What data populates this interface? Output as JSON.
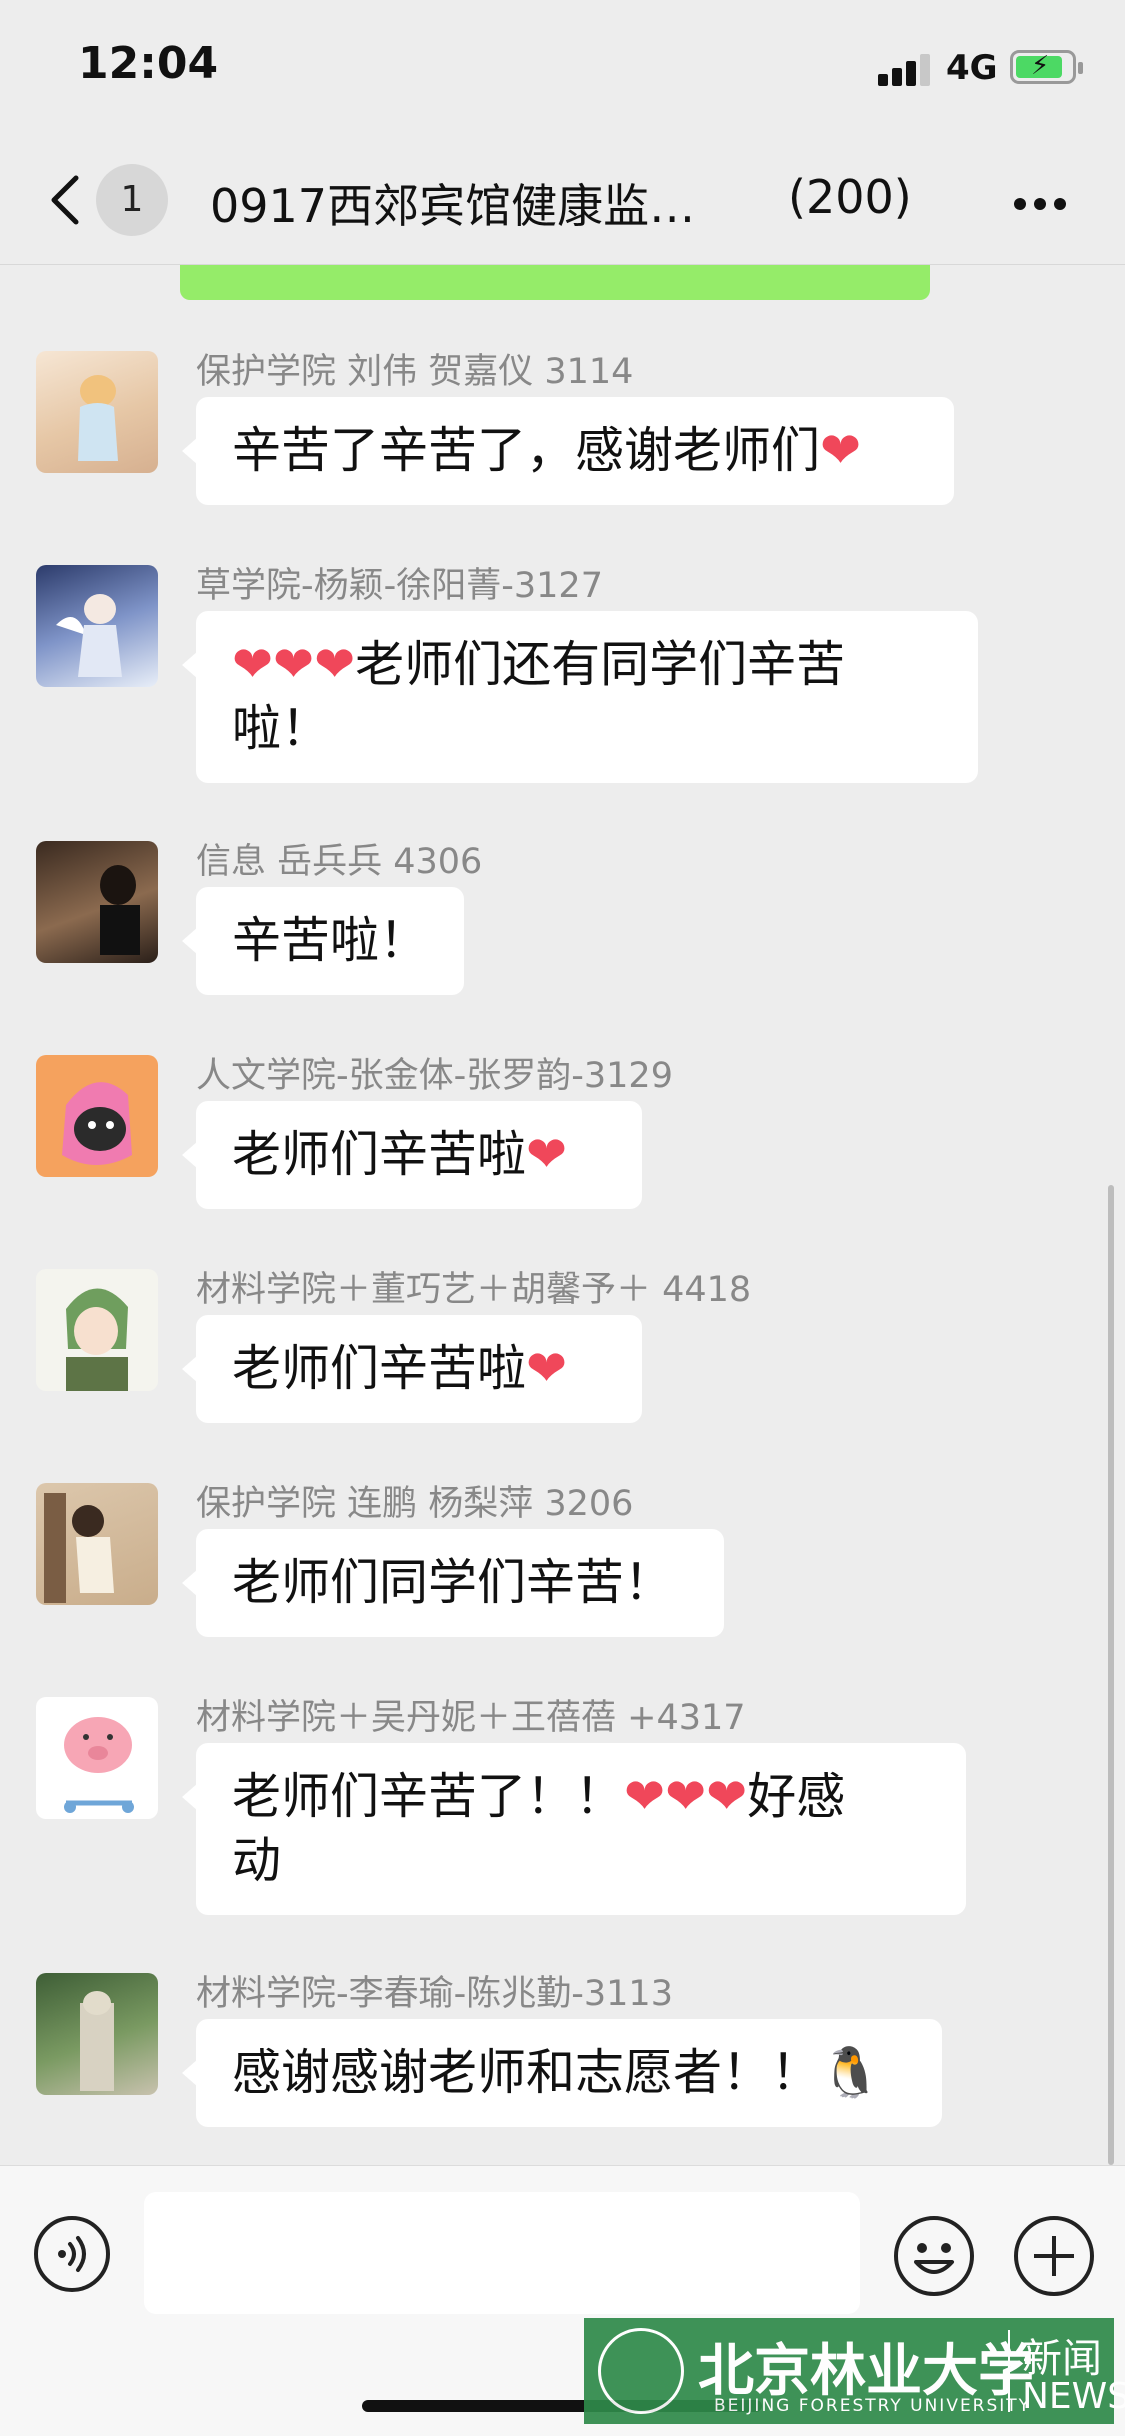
{
  "status_bar": {
    "time": "12:04",
    "network": "4G"
  },
  "nav": {
    "unread": "1",
    "title": "0917西郊宾馆健康监…",
    "member_count": "(200)"
  },
  "messages": [
    {
      "sender": "保护学院 刘伟 贺嘉仪 3114",
      "text": "辛苦了辛苦了，感谢老师们",
      "after": "❤"
    },
    {
      "sender": "草学院-杨颖-徐阳菁-3127",
      "before": "❤❤❤",
      "text": "老师们还有同学们辛苦",
      "text2": "啦！"
    },
    {
      "sender": "信息 岳兵兵 4306",
      "text": "辛苦啦！"
    },
    {
      "sender": "人文学院-张金体-张罗韵-3129",
      "text": "老师们辛苦啦",
      "after": "❤"
    },
    {
      "sender": "材料学院＋董巧艺＋胡馨予＋ 4418",
      "text": "老师们辛苦啦",
      "after": "❤"
    },
    {
      "sender": "保护学院 连鹏 杨梨萍 3206",
      "text": "老师们同学们辛苦！"
    },
    {
      "sender": "材料学院＋吴丹妮＋王蓓蓓 +4317",
      "text": "老师们辛苦了！！",
      "mid": "❤❤❤",
      "text_tail": "好感",
      "text2": "动"
    },
    {
      "sender": "材料学院-李春瑜-陈兆勤-3113",
      "text": "感谢感谢老师和志愿者！！",
      "after": "🐧"
    }
  ],
  "watermark": {
    "cn": "北京林业大学",
    "en": "BEIJING FORESTRY UNIVERSITY",
    "news_cn": "新闻",
    "news_en": "NEWS"
  }
}
